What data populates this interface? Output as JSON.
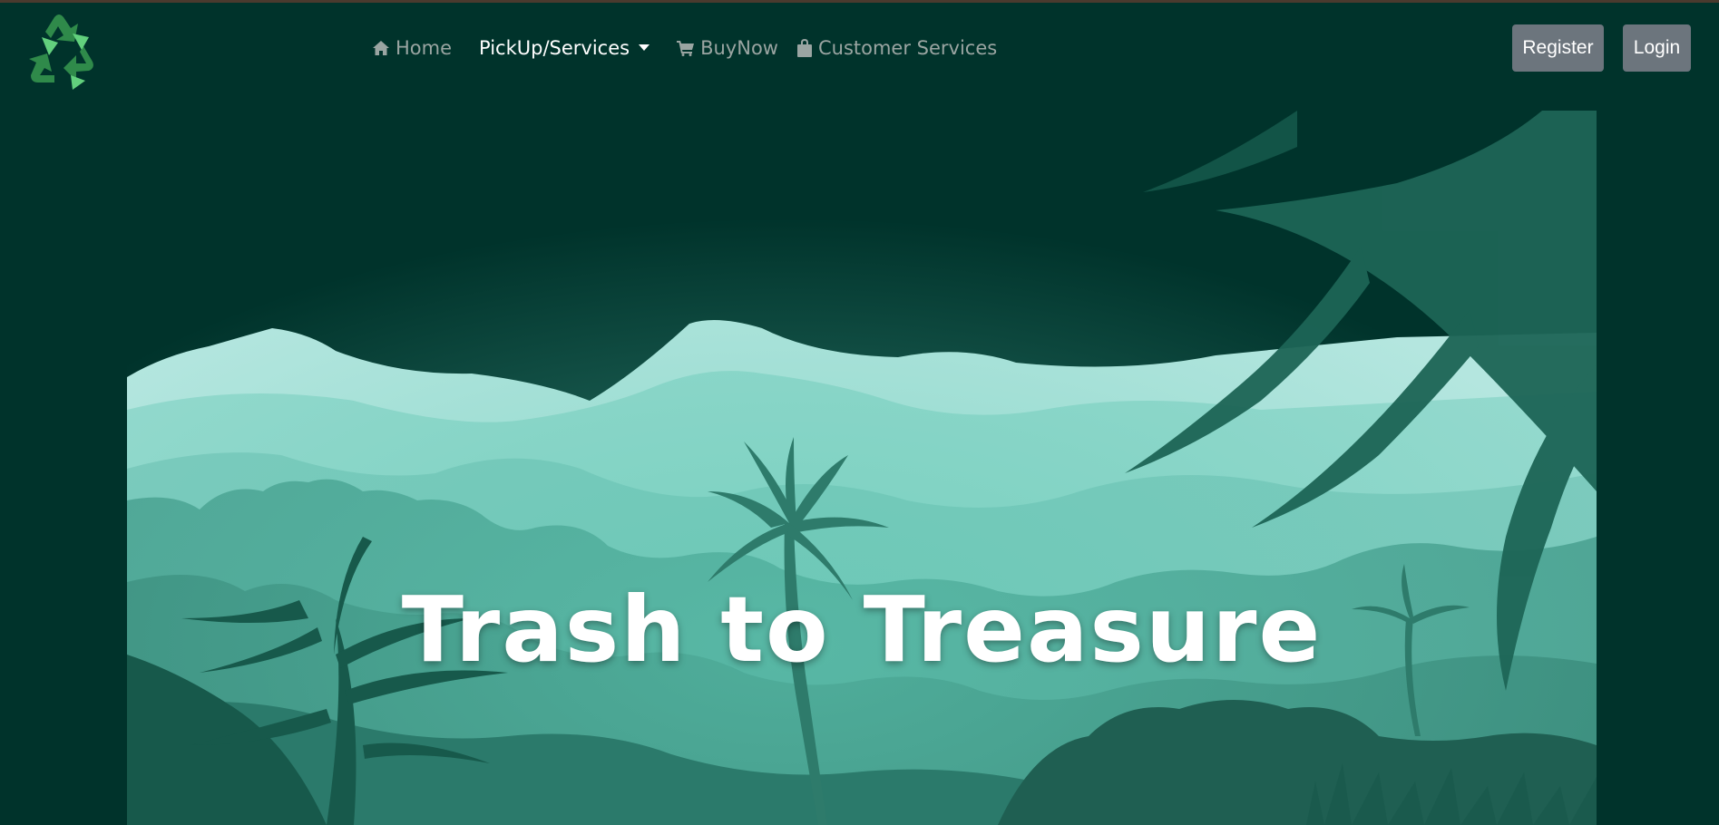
{
  "nav": {
    "items": [
      {
        "label": "Home",
        "icon": "home-icon"
      },
      {
        "label": "PickUp/Services",
        "icon": "chevron-down-icon"
      },
      {
        "label": "BuyNow",
        "icon": "cart-icon"
      },
      {
        "label": "Customer Services",
        "icon": "bag-icon"
      }
    ],
    "register_label": "Register",
    "login_label": "Login"
  },
  "hero": {
    "title": "Trash to Treasure"
  },
  "colors": {
    "background": "#00332b",
    "logo": "#49b065",
    "nav_text": "#9aa5a2",
    "nav_active": "#ffffff",
    "button_bg": "#6c757d"
  }
}
